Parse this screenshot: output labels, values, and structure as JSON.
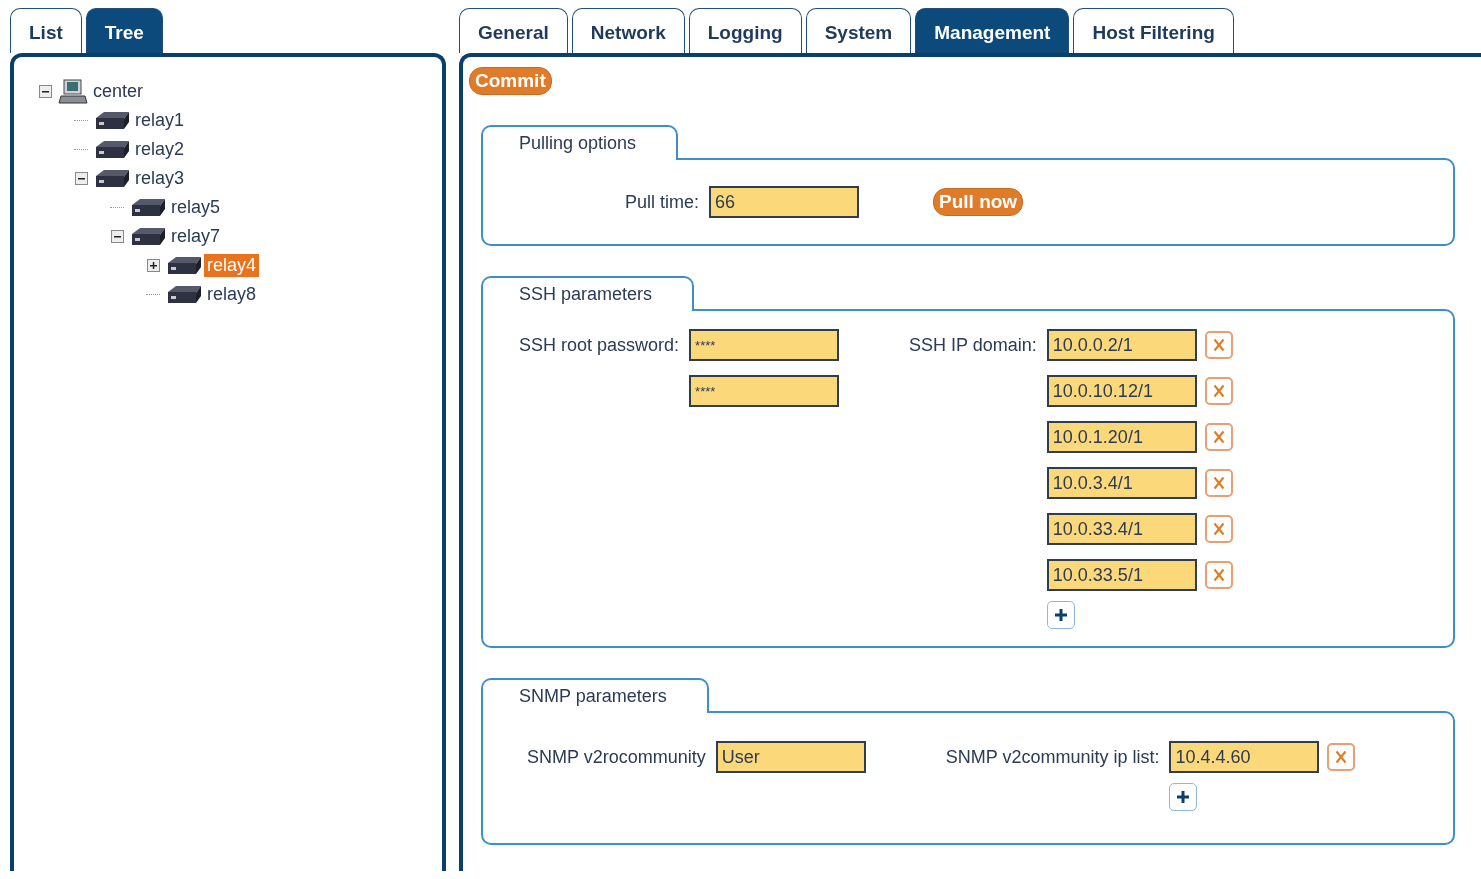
{
  "left_tabs": [
    {
      "label": "List",
      "selected": false
    },
    {
      "label": "Tree",
      "selected": true
    }
  ],
  "tree": [
    {
      "label": "center",
      "kind": "computer",
      "selected": false,
      "expanded": true,
      "children": [
        {
          "label": "relay1",
          "kind": "relay",
          "selected": false
        },
        {
          "label": "relay2",
          "kind": "relay",
          "selected": false
        },
        {
          "label": "relay3",
          "kind": "relay",
          "selected": false,
          "expanded": true,
          "children": [
            {
              "label": "relay5",
              "kind": "relay",
              "selected": false
            },
            {
              "label": "relay7",
              "kind": "relay",
              "selected": false,
              "expanded": true,
              "children": [
                {
                  "label": "relay4",
                  "kind": "relay",
                  "selected": true,
                  "expanded": false
                },
                {
                  "label": "relay8",
                  "kind": "relay",
                  "selected": false
                }
              ]
            }
          ]
        }
      ]
    }
  ],
  "tabs": [
    {
      "label": "General",
      "selected": false
    },
    {
      "label": "Network",
      "selected": false
    },
    {
      "label": "Logging",
      "selected": false
    },
    {
      "label": "System",
      "selected": false
    },
    {
      "label": "Management",
      "selected": true
    },
    {
      "label": "Host Filtering",
      "selected": false
    }
  ],
  "commit_button": "Commit",
  "pulling": {
    "title": "Pulling options",
    "label": "Pull time:",
    "value": "66",
    "button": "Pull now"
  },
  "ssh": {
    "title": "SSH parameters",
    "password_label": "SSH root password:",
    "passwords": [
      "****",
      "****"
    ],
    "domain_label": "SSH IP domain:",
    "domains": [
      "10.0.0.2/1",
      "10.0.10.12/1",
      "10.0.1.20/1",
      "10.0.3.4/1",
      "10.0.33.4/1",
      "10.0.33.5/1"
    ]
  },
  "snmp": {
    "title": "SNMP parameters",
    "community_label": "SNMP v2rocommunity",
    "community": "User",
    "ip_label": "SNMP v2community ip list:",
    "ips": [
      "10.4.4.60"
    ]
  }
}
